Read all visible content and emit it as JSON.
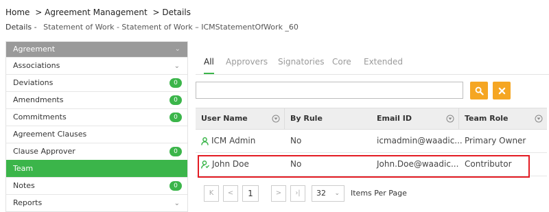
{
  "breadcrumb": {
    "home": "Home",
    "agreement_management": "> Agreement Management",
    "details": "> Details"
  },
  "page_title": {
    "label": "Details",
    "separator": "-",
    "value": "Statement of Work - Statement of Work – ICMStatementOfWork _60"
  },
  "sidebar": {
    "header": "Agreement",
    "items": [
      {
        "label": "Associations",
        "chevron": true
      },
      {
        "label": "Deviations",
        "badge": "0"
      },
      {
        "label": "Amendments",
        "badge": "0"
      },
      {
        "label": "Commitments",
        "badge": "0"
      },
      {
        "label": "Agreement Clauses"
      },
      {
        "label": "Clause Approver",
        "badge": "0"
      },
      {
        "label": "Team",
        "active": true
      },
      {
        "label": "Notes",
        "badge": "0"
      },
      {
        "label": "Reports",
        "chevron": true
      }
    ]
  },
  "tabs": [
    "All",
    "Approvers",
    "Signatories",
    "Core",
    "Extended"
  ],
  "active_tab": "All",
  "search": {
    "value": "",
    "placeholder": ""
  },
  "table": {
    "columns": [
      "User Name",
      "By Rule",
      "Email ID",
      "Team Role"
    ],
    "rows": [
      {
        "user": "ICM Admin",
        "by_rule": "No",
        "email": "icmadmin@waadic...",
        "role": "Primary Owner"
      },
      {
        "user": "John Doe",
        "by_rule": "No",
        "email": "John.Doe@waadic...",
        "role": "Contributor"
      }
    ]
  },
  "pagination": {
    "current_page": "1",
    "page_size": "32",
    "items_per_page_label": "Items Per Page"
  },
  "colors": {
    "accent_green": "#3bb54a",
    "button_orange": "#f5a623",
    "highlight_red": "#e31b23",
    "sidebar_header_gray": "#9a9a9a"
  },
  "icons": {
    "search": "search-icon",
    "clear": "close-icon",
    "filter": "filter-icon",
    "user": "user-icon",
    "chevron": "chevron-down-icon"
  }
}
